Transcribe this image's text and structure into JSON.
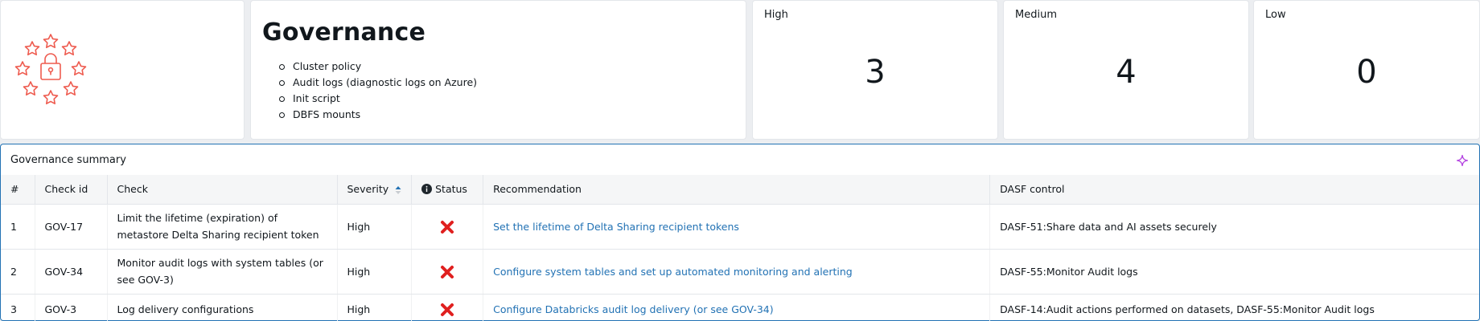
{
  "header": {
    "title": "Governance",
    "items": [
      "Cluster policy",
      "Audit logs (diagnostic logs on Azure)",
      "Init script",
      "DBFS mounts"
    ]
  },
  "metrics": {
    "high": {
      "label": "High",
      "value": "3"
    },
    "medium": {
      "label": "Medium",
      "value": "4"
    },
    "low": {
      "label": "Low",
      "value": "0"
    }
  },
  "table": {
    "title": "Governance summary",
    "columns": {
      "num": "#",
      "check_id": "Check id",
      "check": "Check",
      "severity": "Severity",
      "status": "Status",
      "recommendation": "Recommendation",
      "dasf": "DASF control"
    },
    "rows": [
      {
        "num": "1",
        "check_id": "GOV-17",
        "check": "Limit the lifetime (expiration) of metastore Delta Sharing recipient token",
        "severity": "High",
        "status": "fail",
        "recommendation": "Set the lifetime of Delta Sharing recipient tokens",
        "dasf": "DASF-51:Share data and AI assets securely"
      },
      {
        "num": "2",
        "check_id": "GOV-34",
        "check": "Monitor audit logs with system tables (or see GOV-3)",
        "severity": "High",
        "status": "fail",
        "recommendation": "Configure system tables and set up automated monitoring and alerting",
        "dasf": "DASF-55:Monitor Audit logs"
      },
      {
        "num": "3",
        "check_id": "GOV-3",
        "check": "Log delivery configurations",
        "severity": "High",
        "status": "fail",
        "recommendation": "Configure Databricks audit log delivery (or see GOV-34)",
        "dasf": "DASF-14:Audit actions performed on datasets, DASF-55:Monitor Audit logs"
      }
    ]
  },
  "colors": {
    "accent": "#2272b4",
    "fail": "#e0201f",
    "logo": "#ee5b4f",
    "sparkle": "#b240e0"
  },
  "icons": {
    "logo": "lock-stars-icon",
    "sparkle": "sparkle-icon",
    "info": "info-icon",
    "sort": "sort-ascending-icon",
    "fail": "x-mark-icon"
  }
}
